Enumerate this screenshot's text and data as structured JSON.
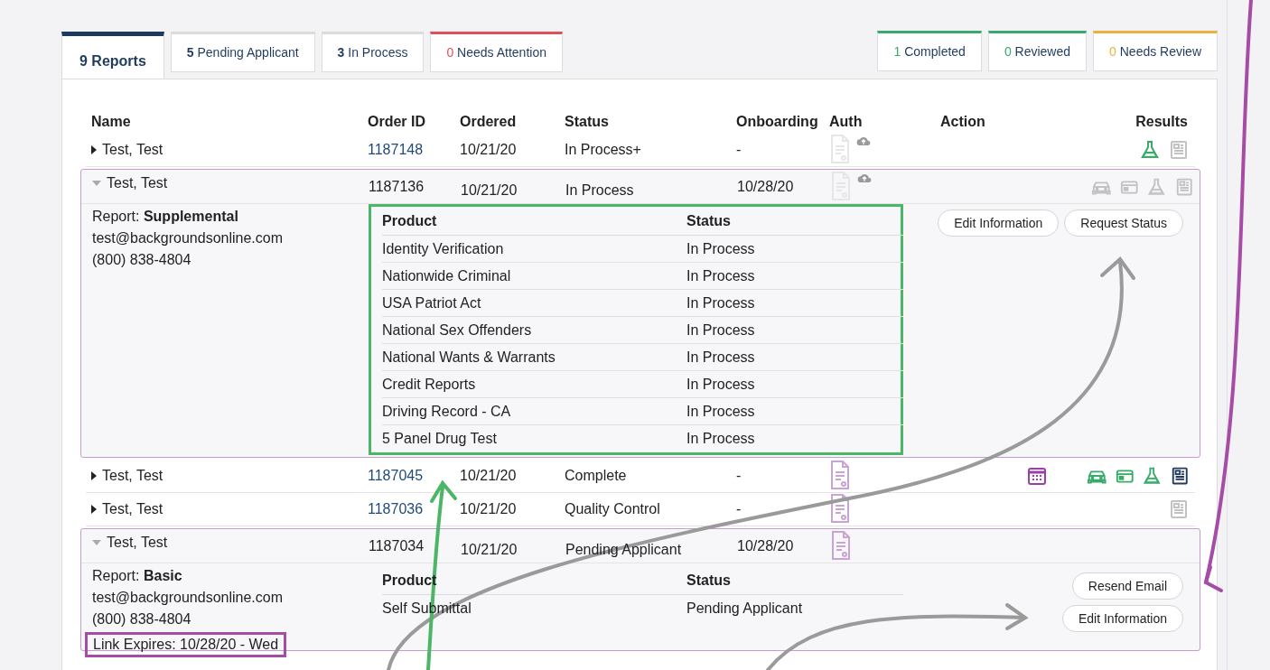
{
  "tabs_left": [
    {
      "count": "9",
      "label": "Reports",
      "selected": true
    },
    {
      "count": "5",
      "label": "Pending Applicant",
      "selected": false
    },
    {
      "count": "3",
      "label": "In Process",
      "selected": false
    },
    {
      "count": "0",
      "label": "Needs Attention",
      "selected": false,
      "color": "#e0505a"
    }
  ],
  "tabs_right": [
    {
      "count": "1",
      "label": "Completed",
      "selected": false,
      "color": "#3aaa6a"
    },
    {
      "count": "0",
      "label": "Reviewed",
      "selected": false,
      "color": "#3aaa6a"
    },
    {
      "count": "0",
      "label": "Needs Review",
      "selected": false,
      "color": "#f0b040"
    }
  ],
  "table": {
    "columns": [
      "Name",
      "Order ID",
      "Ordered",
      "Status",
      "Onboarding",
      "Auth",
      "Action",
      "Results"
    ],
    "rows": [
      {
        "name": "Test, Test",
        "order_id": "1187148",
        "ordered": "10/21/20",
        "status": "In Process+",
        "onboarding": "-",
        "expanded": false,
        "auth": {
          "faint": true,
          "upload": true
        },
        "results": [
          {
            "kind": "flask",
            "color": "#3aaa6a"
          },
          {
            "kind": "report",
            "color": "#c2c2c2"
          }
        ]
      },
      {
        "name": "Test, Test",
        "order_id": "1187136",
        "ordered": "10/21/20",
        "status": "In Process",
        "onboarding": "10/28/20",
        "expanded": true,
        "auth": {
          "faint": true,
          "upload": true
        },
        "results": [
          {
            "kind": "car",
            "color": "#c2c2c2"
          },
          {
            "kind": "card",
            "color": "#c2c2c2"
          },
          {
            "kind": "flask",
            "color": "#c2c2c2"
          },
          {
            "kind": "report",
            "color": "#c2c2c2"
          }
        ],
        "detail": {
          "report_label": "Report:",
          "report_type": "Supplemental",
          "email": "test@backgroundsonline.com",
          "phone": "(800) 838-4804",
          "product_header": "Product",
          "status_header": "Status",
          "highlighted": true,
          "products": [
            {
              "product": "Identity Verification",
              "status": "In Process"
            },
            {
              "product": "Nationwide Criminal",
              "status": "In Process"
            },
            {
              "product": "USA Patriot Act",
              "status": "In Process"
            },
            {
              "product": "National Sex Offenders",
              "status": "In Process"
            },
            {
              "product": "National Wants & Warrants",
              "status": "In Process"
            },
            {
              "product": "Credit Reports",
              "status": "In Process"
            },
            {
              "product": "Driving Record - CA",
              "status": "In Process"
            },
            {
              "product": "5 Panel Drug Test",
              "status": "In Process"
            }
          ],
          "buttons": [
            "Edit Information",
            "Request Status"
          ],
          "stacked_buttons": false
        }
      },
      {
        "name": "Test, Test",
        "order_id": "1187045",
        "ordered": "10/21/20",
        "status": "Complete",
        "onboarding": "-",
        "expanded": false,
        "auth": {
          "faint": false,
          "upload": false
        },
        "scheduled": true,
        "results": [
          {
            "kind": "car",
            "color": "#3aaa6a"
          },
          {
            "kind": "card",
            "color": "#3aaa6a"
          },
          {
            "kind": "flask",
            "color": "#3aaa6a"
          },
          {
            "kind": "report",
            "color": "#1f3a5f"
          }
        ]
      },
      {
        "name": "Test, Test",
        "order_id": "1187036",
        "ordered": "10/21/20",
        "status": "Quality Control",
        "onboarding": "-",
        "expanded": false,
        "auth": {
          "faint": false,
          "upload": false
        },
        "results": [
          {
            "kind": "report",
            "color": "#c2c2c2"
          }
        ]
      },
      {
        "name": "Test, Test",
        "order_id": "1187034",
        "ordered": "10/21/20",
        "status": "Pending Applicant",
        "onboarding": "10/28/20",
        "expanded": true,
        "auth": {
          "faint": false,
          "upload": false
        },
        "results": [],
        "detail": {
          "report_label": "Report:",
          "report_type": "Basic",
          "email": "test@backgroundsonline.com",
          "phone": "(800) 838-4804",
          "link_expires": "Link Expires: 10/28/20 - Wed",
          "link_highlighted": true,
          "product_header": "Product",
          "status_header": "Status",
          "highlighted": false,
          "products": [
            {
              "product": "Self Submittal",
              "status": "Pending Applicant"
            }
          ],
          "buttons": [
            "Resend Email",
            "Edit Information"
          ],
          "stacked_buttons": true
        }
      }
    ]
  },
  "annotations": [
    {
      "kind": "arrow",
      "color": "#a64ca6"
    },
    {
      "kind": "arrow",
      "color": "#9a9a9a"
    },
    {
      "kind": "arrow",
      "color": "#4cb566"
    },
    {
      "kind": "arrow",
      "color": "#9a9a9a"
    }
  ]
}
